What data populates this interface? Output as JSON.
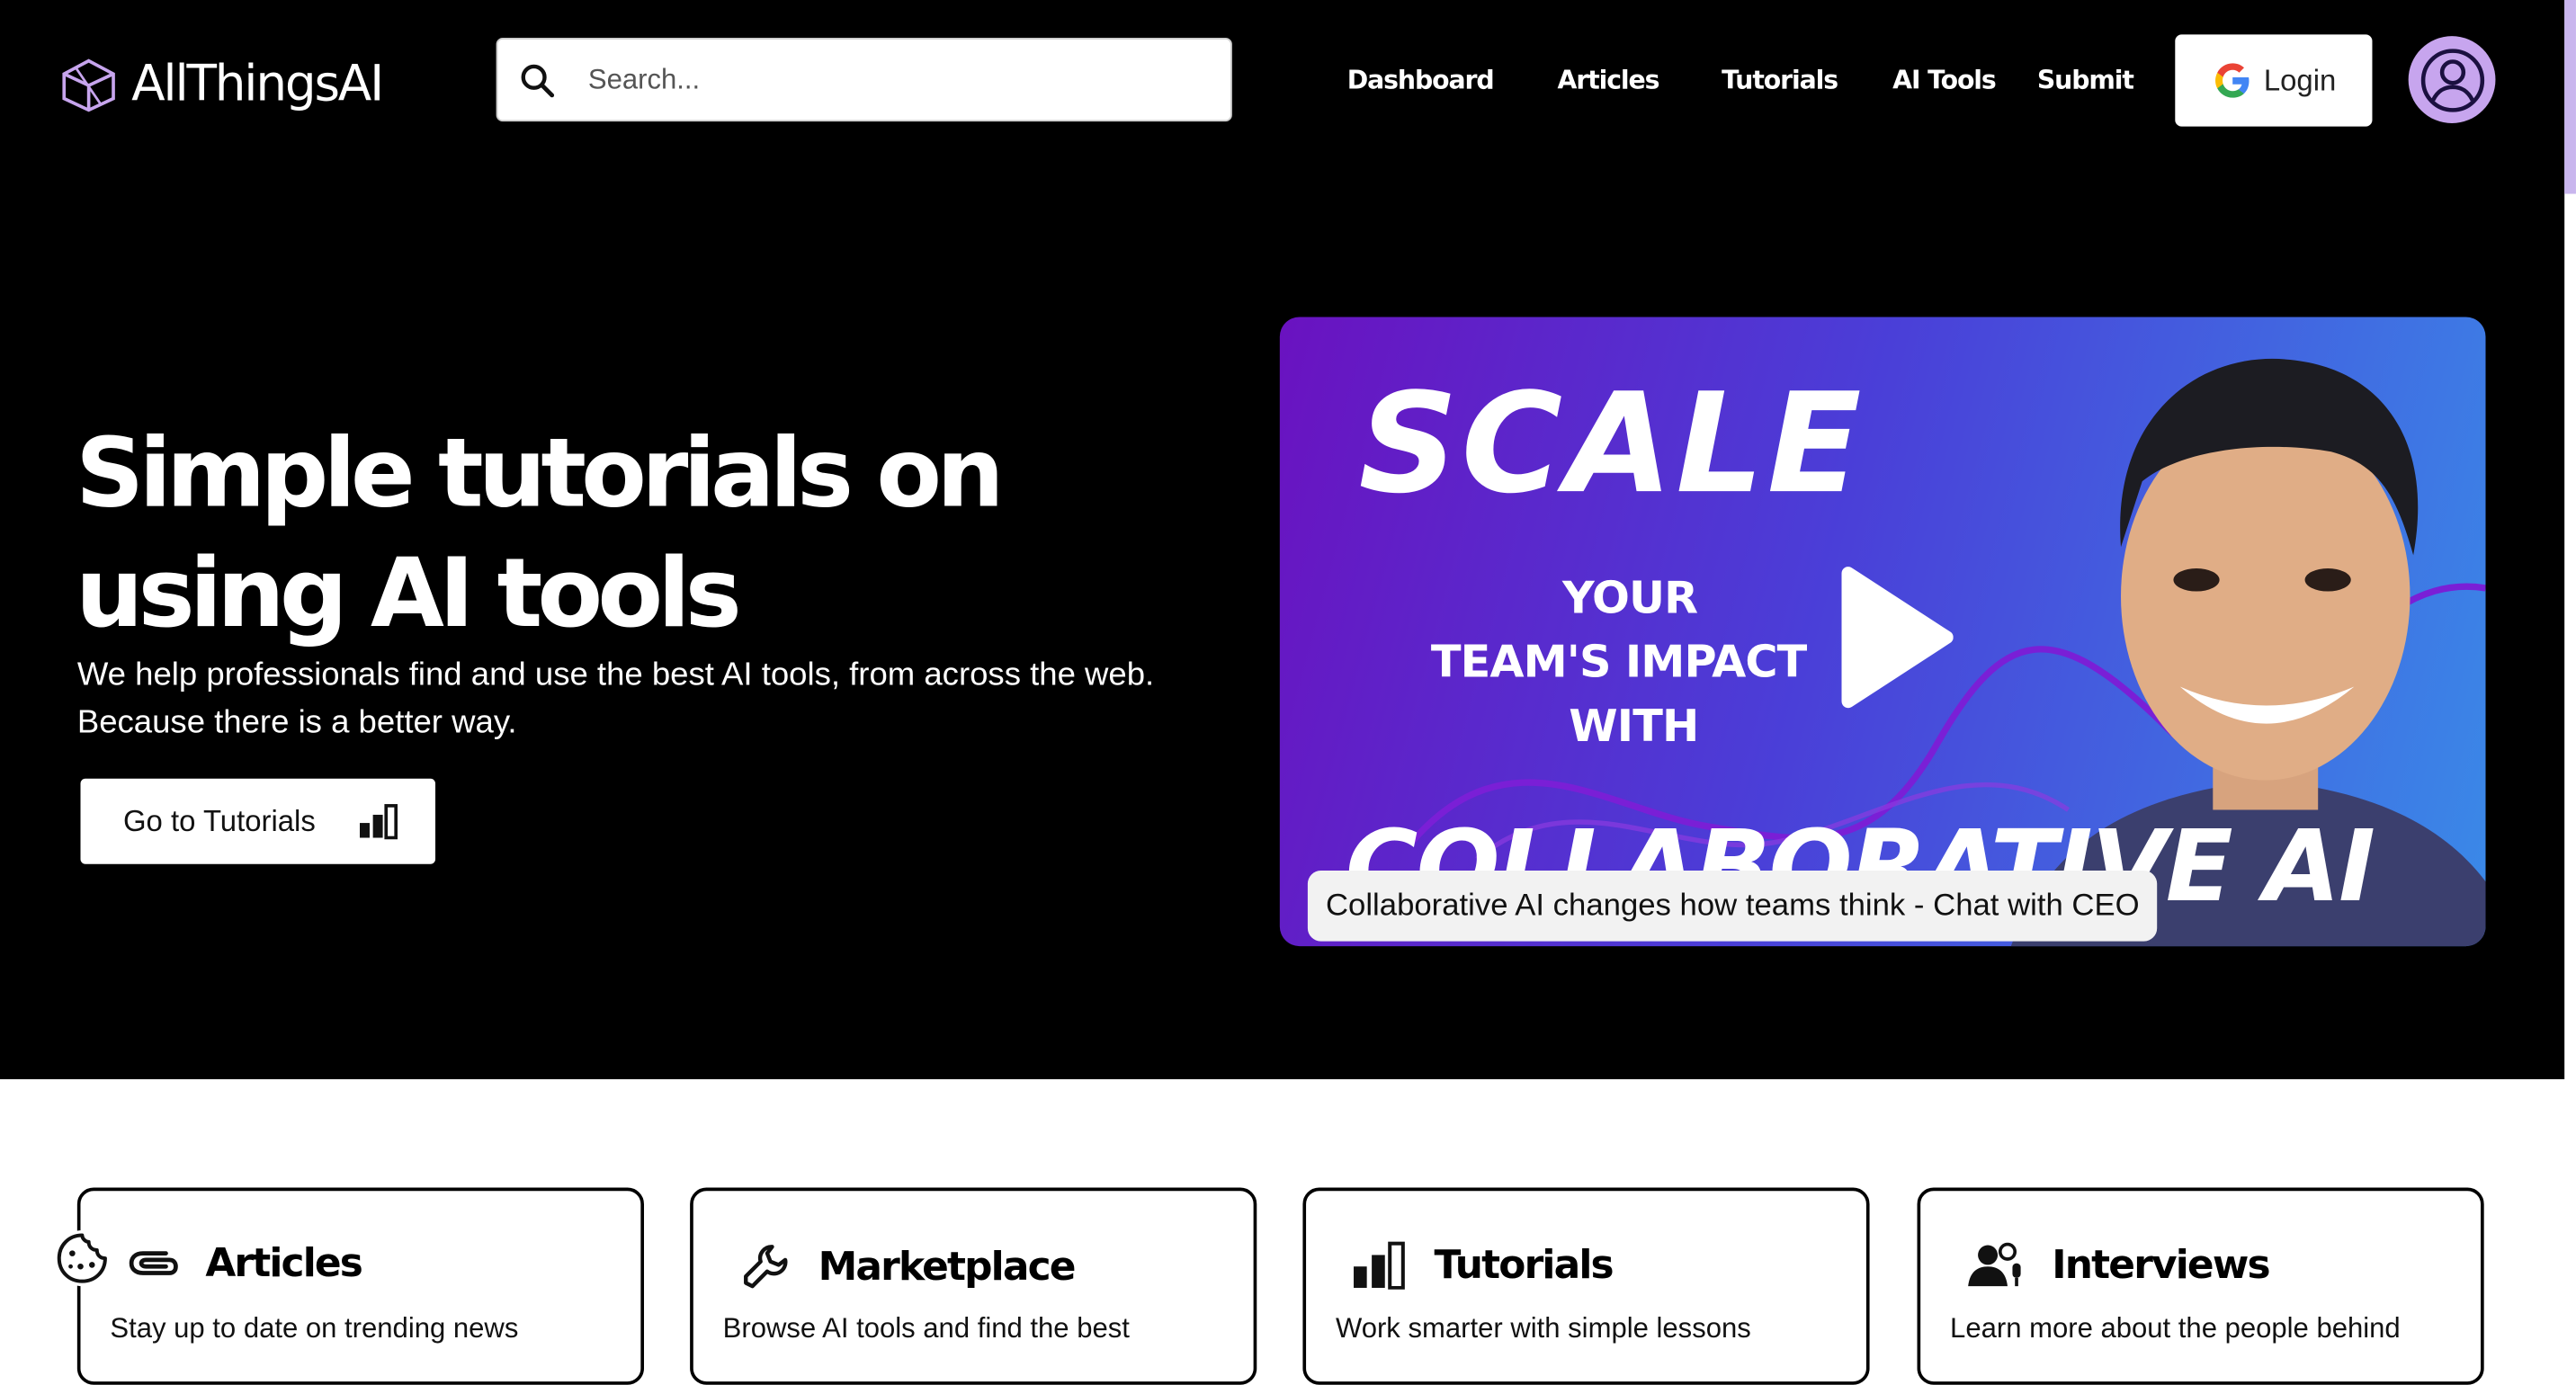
{
  "brand": {
    "name": "AllThingsAI"
  },
  "search": {
    "placeholder": "Search..."
  },
  "nav": {
    "items": [
      "Dashboard",
      "Articles",
      "Tutorials",
      "AI Tools",
      "Submit"
    ]
  },
  "auth": {
    "login_label": "Login"
  },
  "hero": {
    "title_line1": "Simple tutorials on",
    "title_line2": "using AI tools",
    "subtitle": "We help professionals find and use the best AI tools, from across the web. Because there is a better way.",
    "cta_label": "Go to Tutorials"
  },
  "video": {
    "thumb_line1": "SCALE",
    "thumb_line2": "YOUR",
    "thumb_line3": "TEAM'S IMPACT",
    "thumb_line4": "WITH",
    "thumb_line5": "COLLABORATIVE AI",
    "caption": "Collaborative AI changes how teams think - Chat with CEO"
  },
  "cards": [
    {
      "title": "Articles",
      "desc": "Stay up to date on trending news",
      "icon": "paperclip-icon"
    },
    {
      "title": "Marketplace",
      "desc": "Browse AI tools and find the best",
      "icon": "wrench-icon"
    },
    {
      "title": "Tutorials",
      "desc": "Work smarter with simple lessons",
      "icon": "bar-chart-icon"
    },
    {
      "title": "Interviews",
      "desc": "Learn more about the people behind",
      "icon": "people-icon"
    }
  ],
  "colors": {
    "accent": "#c7a5ee",
    "video_start": "#6a12c0",
    "video_end": "#3a8ae8"
  }
}
